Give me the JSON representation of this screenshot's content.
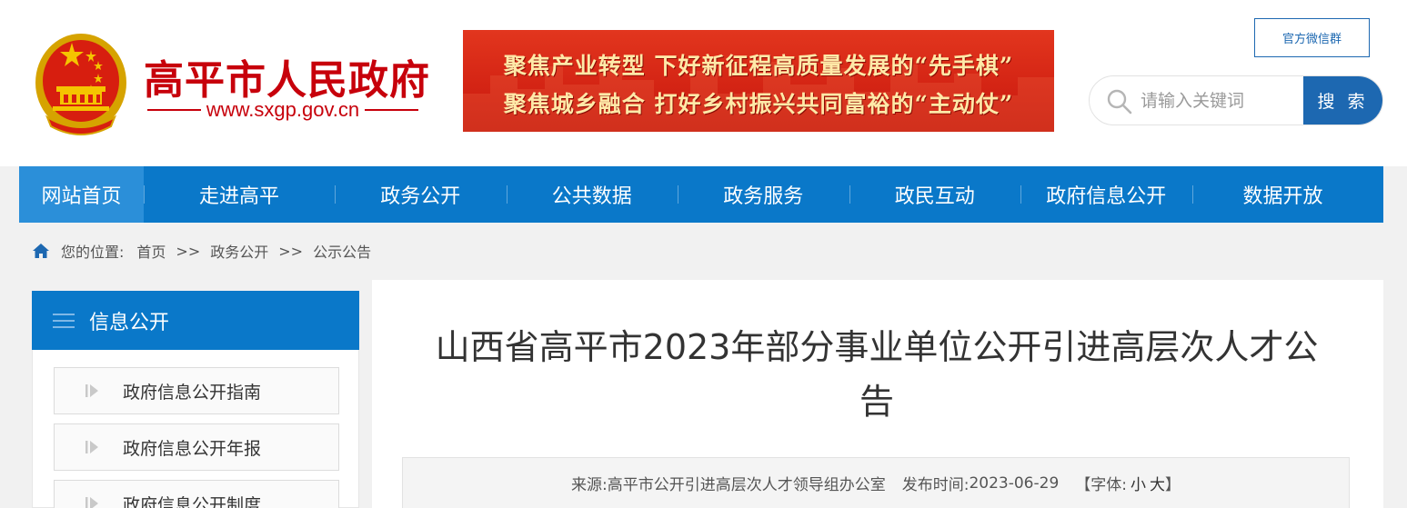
{
  "header": {
    "site_name": "高平市人民政府",
    "site_url": "www.sxgp.gov.cn",
    "banner_line1": "聚焦产业转型  下好新征程高质量发展的“先手棋”",
    "banner_line2": "聚焦城乡融合  打好乡村振兴共同富裕的“主动仗”",
    "wechat_label": "官方微信群",
    "search_placeholder": "请输入关键词",
    "search_button": "搜 索"
  },
  "nav": {
    "items": [
      "网站首页",
      "走进高平",
      "政务公开",
      "公共数据",
      "政务服务",
      "政民互动",
      "政府信息公开",
      "数据开放"
    ],
    "active_index": 0
  },
  "breadcrumb": {
    "prefix": "您的位置:",
    "items": [
      "首页",
      "政务公开",
      "公示公告"
    ],
    "separator": ">>"
  },
  "sidebar": {
    "title": "信息公开",
    "items": [
      "政府信息公开指南",
      "政府信息公开年报",
      "政府信息公开制度"
    ]
  },
  "article": {
    "title_line1": "山西省高平市2023年部分事业单位公开引进高层次人才公",
    "title_line2": "告",
    "source_label": "来源:",
    "source": "高平市公开引进高层次人才领导组办公室",
    "date_label": "发布时间:",
    "date": "2023-06-29",
    "font_label": "【字体:",
    "font_small": "小",
    "font_large": "大",
    "font_close": "】"
  },
  "colors": {
    "brand_red": "#c7000b",
    "nav_blue": "#0a78c9",
    "button_blue": "#1d68b1"
  }
}
